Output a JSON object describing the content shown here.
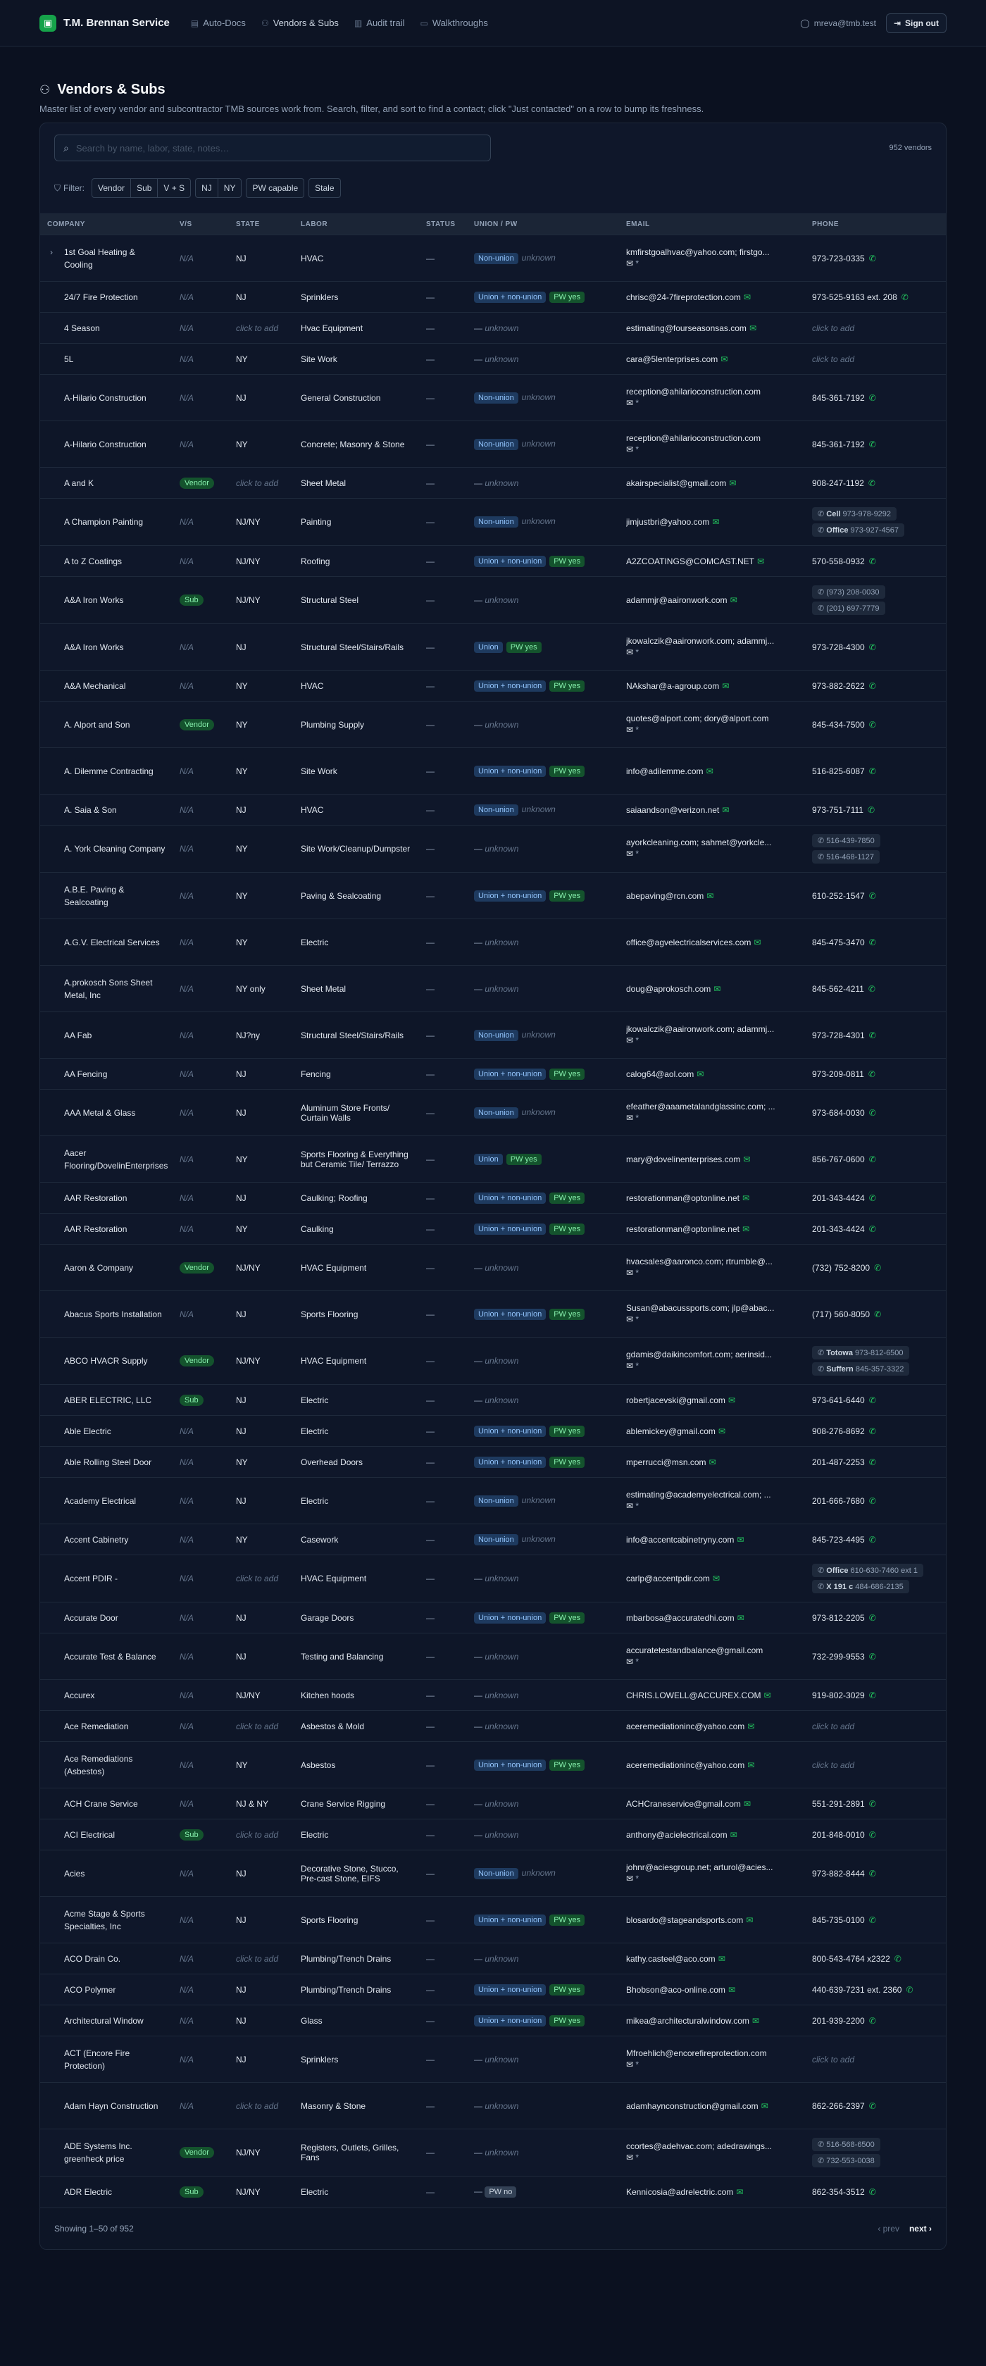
{
  "app": {
    "brand": "T.M. Brennan Service",
    "nav": [
      {
        "label": "Auto-Docs",
        "icon": "doc-icon"
      },
      {
        "label": "Vendors & Subs",
        "icon": "users-icon"
      },
      {
        "label": "Audit trail",
        "icon": "clipboard-icon"
      },
      {
        "label": "Walkthroughs",
        "icon": "video-icon"
      }
    ],
    "user": "mreva@tmb.test",
    "signout": "Sign out"
  },
  "page": {
    "title": "Vendors & Subs",
    "subtitle": "Master list of every vendor and subcontractor TMB sources work from. Search, filter, and sort to find a contact; click \"Just contacted\" on a row to bump its freshness."
  },
  "search": {
    "placeholder": "Search by name, labor, state, notes…",
    "count": "952 vendors"
  },
  "filters": {
    "label": "Filter:",
    "group1": [
      "Vendor",
      "Sub",
      "V + S"
    ],
    "group2": [
      "NJ",
      "NY"
    ],
    "pw": "PW capable",
    "stale": "Stale"
  },
  "columns": [
    "Company",
    "V/S",
    "State",
    "Labor",
    "Status",
    "Union / PW",
    "Email",
    "Phone"
  ],
  "rows": [
    {
      "company": "1st Goal Heating & Cooling",
      "vs": "N/A",
      "state": "NJ",
      "labor": "HVAC",
      "status": "—",
      "union": "Non-union",
      "pw": "unknown",
      "email": "kmfirstgoalhvac@yahoo.com; firstgo...",
      "email_more": true,
      "phone": "973-723-0335",
      "tall": true,
      "chev": true
    },
    {
      "company": "24/7 Fire Protection",
      "vs": "N/A",
      "state": "NJ",
      "labor": "Sprinklers",
      "status": "—",
      "union": "Union + non-union",
      "pw": "PW yes",
      "email": "chrisc@24-7fireprotection.com",
      "phone": "973-525-9163 ext. 208"
    },
    {
      "company": "4 Season",
      "vs": "N/A",
      "state": "click to add",
      "labor": "Hvac Equipment",
      "status": "—",
      "union": "",
      "pw": "unknown",
      "email": "estimating@fourseasonsas.com",
      "phone": "click to add"
    },
    {
      "company": "5L",
      "vs": "N/A",
      "state": "NY",
      "labor": "Site Work",
      "status": "—",
      "union": "",
      "pw": "unknown",
      "email": "cara@5lenterprises.com",
      "phone": "click to add"
    },
    {
      "company": "A-Hilario Construction",
      "vs": "N/A",
      "state": "NJ",
      "labor": "General Construction",
      "status": "—",
      "union": "Non-union",
      "pw": "unknown",
      "email": "reception@ahilarioconstruction.com",
      "email_more": true,
      "phone": "845-361-7192",
      "tall": true
    },
    {
      "company": "A-Hilario Construction",
      "vs": "N/A",
      "state": "NY",
      "labor": "Concrete; Masonry & Stone",
      "status": "—",
      "union": "Non-union",
      "pw": "unknown",
      "email": "reception@ahilarioconstruction.com",
      "email_more": true,
      "phone": "845-361-7192",
      "tall": true
    },
    {
      "company": "A and K",
      "vs": "Vendor",
      "state": "click to add",
      "labor": "Sheet Metal",
      "status": "—",
      "union": "",
      "pw": "unknown",
      "email": "akairspecialist@gmail.com",
      "phone": "908-247-1192"
    },
    {
      "company": "A Champion Painting",
      "vs": "N/A",
      "state": "NJ/NY",
      "labor": "Painting",
      "status": "—",
      "union": "Non-union",
      "pw": "unknown",
      "email": "jimjustbri@yahoo.com",
      "phones": [
        [
          "Cell",
          "973-978-9292"
        ],
        [
          "Office",
          "973-927-4567"
        ]
      ],
      "tall": true
    },
    {
      "company": "A to Z Coatings",
      "vs": "N/A",
      "state": "NJ/NY",
      "labor": "Roofing",
      "status": "—",
      "union": "Union + non-union",
      "pw": "PW yes",
      "email": "A2ZCOATINGS@COMCAST.NET",
      "phone": "570-558-0932"
    },
    {
      "company": "A&A Iron Works",
      "vs": "Sub",
      "state": "NJ/NY",
      "labor": "Structural Steel",
      "status": "—",
      "union": "",
      "pw": "unknown",
      "email": "adammjr@aaironwork.com",
      "phones": [
        [
          "",
          "(973) 208-0030"
        ],
        [
          "",
          "(201) 697-7779"
        ]
      ],
      "tall": true
    },
    {
      "company": "A&A Iron Works",
      "vs": "N/A",
      "state": "NJ",
      "labor": "Structural Steel/Stairs/Rails",
      "status": "—",
      "union": "Union",
      "pw": "PW yes",
      "email": "jkowalczik@aaironwork.com; adammj...",
      "email_more": true,
      "phone": "973-728-4300",
      "tall": true
    },
    {
      "company": "A&A Mechanical",
      "vs": "N/A",
      "state": "NY",
      "labor": "HVAC",
      "status": "—",
      "union": "Union + non-union",
      "pw": "PW yes",
      "email": "NAkshar@a-agroup.com",
      "phone": "973-882-2622"
    },
    {
      "company": "A. Alport and Son",
      "vs": "Vendor",
      "state": "NY",
      "labor": "Plumbing Supply",
      "status": "—",
      "union": "",
      "pw": "unknown",
      "email": "quotes@alport.com; dory@alport.com",
      "email_more": true,
      "phone": "845-434-7500",
      "tall": true
    },
    {
      "company": "A. Dilemme Contracting",
      "vs": "N/A",
      "state": "NY",
      "labor": "Site Work",
      "status": "—",
      "union": "Union + non-union",
      "pw": "PW yes",
      "email": "info@adilemme.com",
      "phone": "516-825-6087",
      "tall": true
    },
    {
      "company": "A. Saia & Son",
      "vs": "N/A",
      "state": "NJ",
      "labor": "HVAC",
      "status": "—",
      "union": "Non-union",
      "pw": "unknown",
      "email": "saiaandson@verizon.net",
      "phone": "973-751-7111"
    },
    {
      "company": "A. York Cleaning Company",
      "vs": "N/A",
      "state": "NY",
      "labor": "Site Work/Cleanup/Dumpster",
      "status": "—",
      "union": "",
      "pw": "unknown",
      "email": "ayorkcleaning.com; sahmet@yorkcle...",
      "email_more": true,
      "phones": [
        [
          "",
          "516-439-7850"
        ],
        [
          "",
          "516-468-1127"
        ]
      ],
      "tall": true
    },
    {
      "company": "A.B.E. Paving & Sealcoating",
      "vs": "N/A",
      "state": "NY",
      "labor": "Paving & Sealcoating",
      "status": "—",
      "union": "Union + non-union",
      "pw": "PW yes",
      "email": "abepaving@rcn.com",
      "phone": "610-252-1547",
      "tall": true
    },
    {
      "company": "A.G.V. Electrical Services",
      "vs": "N/A",
      "state": "NY",
      "labor": "Electric",
      "status": "—",
      "union": "",
      "pw": "unknown",
      "email": "office@agvelectricalservices.com",
      "phone": "845-475-3470",
      "tall": true
    },
    {
      "company": "A.prokosch Sons Sheet Metal, Inc",
      "vs": "N/A",
      "state": "NY only",
      "labor": "Sheet Metal",
      "status": "—",
      "union": "",
      "pw": "unknown",
      "email": "doug@aprokosch.com",
      "phone": "845-562-4211",
      "tall": true
    },
    {
      "company": "AA Fab",
      "vs": "N/A",
      "state": "NJ?ny",
      "labor": "Structural Steel/Stairs/Rails",
      "status": "—",
      "union": "Non-union",
      "pw": "unknown",
      "email": "jkowalczik@aaironwork.com; adammj...",
      "email_more": true,
      "phone": "973-728-4301",
      "tall": true
    },
    {
      "company": "AA Fencing",
      "vs": "N/A",
      "state": "NJ",
      "labor": "Fencing",
      "status": "—",
      "union": "Union + non-union",
      "pw": "PW yes",
      "email": "calog64@aol.com",
      "phone": "973-209-0811"
    },
    {
      "company": "AAA Metal & Glass",
      "vs": "N/A",
      "state": "NJ",
      "labor": "Aluminum Store Fronts/ Curtain Walls",
      "status": "—",
      "union": "Non-union",
      "pw": "unknown",
      "email": "efeather@aaametalandglassinc.com; ...",
      "email_more": true,
      "phone": "973-684-0030",
      "tall": true
    },
    {
      "company": "Aacer Flooring/DovelinEnterprises",
      "vs": "N/A",
      "state": "NY",
      "labor": "Sports Flooring & Everything but Ceramic Tile/ Terrazzo",
      "status": "—",
      "union": "Union",
      "pw": "PW yes",
      "email": "mary@dovelinenterprises.com",
      "phone": "856-767-0600",
      "tall": true
    },
    {
      "company": "AAR Restoration",
      "vs": "N/A",
      "state": "NJ",
      "labor": "Caulking; Roofing",
      "status": "—",
      "union": "Union + non-union",
      "pw": "PW yes",
      "email": "restorationman@optonline.net",
      "phone": "201-343-4424"
    },
    {
      "company": "AAR Restoration",
      "vs": "N/A",
      "state": "NY",
      "labor": "Caulking",
      "status": "—",
      "union": "Union + non-union",
      "pw": "PW yes",
      "email": "restorationman@optonline.net",
      "phone": "201-343-4424"
    },
    {
      "company": "Aaron & Company",
      "vs": "Vendor",
      "state": "NJ/NY",
      "labor": "HVAC Equipment",
      "status": "—",
      "union": "",
      "pw": "unknown",
      "email": "hvacsales@aaronco.com; rtrumble@...",
      "email_more": true,
      "phone": "(732) 752-8200",
      "tall": true
    },
    {
      "company": "Abacus Sports Installation",
      "vs": "N/A",
      "state": "NJ",
      "labor": "Sports Flooring",
      "status": "—",
      "union": "Union + non-union",
      "pw": "PW yes",
      "email": "Susan@abacussports.com; jlp@abac...",
      "email_more": true,
      "phone": "(717) 560-8050",
      "tall": true
    },
    {
      "company": "ABCO HVACR Supply",
      "vs": "Vendor",
      "state": "NJ/NY",
      "labor": "HVAC Equipment",
      "status": "—",
      "union": "",
      "pw": "unknown",
      "email": "gdamis@daikincomfort.com; aerinsid...",
      "email_more": true,
      "phones": [
        [
          "Totowa",
          "973-812-6500"
        ],
        [
          "Suffern",
          "845-357-3322"
        ]
      ],
      "tall": true
    },
    {
      "company": "ABER ELECTRIC, LLC",
      "vs": "Sub",
      "state": "NJ",
      "labor": "Electric",
      "status": "—",
      "union": "",
      "pw": "unknown",
      "email": "robertjacevski@gmail.com",
      "phone": "973-641-6440"
    },
    {
      "company": "Able Electric",
      "vs": "N/A",
      "state": "NJ",
      "labor": "Electric",
      "status": "—",
      "union": "Union + non-union",
      "pw": "PW yes",
      "email": "ablemickey@gmail.com",
      "phone": "908-276-8692"
    },
    {
      "company": "Able Rolling Steel Door",
      "vs": "N/A",
      "state": "NY",
      "labor": "Overhead Doors",
      "status": "—",
      "union": "Union + non-union",
      "pw": "PW yes",
      "email": "mperrucci@msn.com",
      "phone": "201-487-2253"
    },
    {
      "company": "Academy Electrical",
      "vs": "N/A",
      "state": "NJ",
      "labor": "Electric",
      "status": "—",
      "union": "Non-union",
      "pw": "unknown",
      "email": "estimating@academyelectrical.com; ...",
      "email_more": true,
      "phone": "201-666-7680",
      "tall": true
    },
    {
      "company": "Accent Cabinetry",
      "vs": "N/A",
      "state": "NY",
      "labor": "Casework",
      "status": "—",
      "union": "Non-union",
      "pw": "unknown",
      "email": "info@accentcabinetryny.com",
      "phone": "845-723-4495"
    },
    {
      "company": "Accent PDIR -",
      "vs": "N/A",
      "state": "click to add",
      "labor": "HVAC Equipment",
      "status": "—",
      "union": "",
      "pw": "unknown",
      "email": "carlp@accentpdir.com",
      "phones": [
        [
          "Office",
          "610-630-7460 ext 1"
        ],
        [
          "X 191 c",
          "484-686-2135"
        ]
      ],
      "tall": true
    },
    {
      "company": "Accurate Door",
      "vs": "N/A",
      "state": "NJ",
      "labor": "Garage Doors",
      "status": "—",
      "union": "Union + non-union",
      "pw": "PW yes",
      "email": "mbarbosa@accuratedhi.com",
      "phone": "973-812-2205"
    },
    {
      "company": "Accurate Test & Balance",
      "vs": "N/A",
      "state": "NJ",
      "labor": "Testing and Balancing",
      "status": "—",
      "union": "",
      "pw": "unknown",
      "email": "accuratetestandbalance@gmail.com",
      "email_more": true,
      "phone": "732-299-9553",
      "tall": true
    },
    {
      "company": "Accurex",
      "vs": "N/A",
      "state": "NJ/NY",
      "labor": "Kitchen hoods",
      "status": "—",
      "union": "",
      "pw": "unknown",
      "email": "CHRIS.LOWELL@ACCUREX.COM",
      "phone": "919-802-3029"
    },
    {
      "company": "Ace Remediation",
      "vs": "N/A",
      "state": "click to add",
      "labor": "Asbestos & Mold",
      "status": "—",
      "union": "",
      "pw": "unknown",
      "email": "aceremediationinc@yahoo.com",
      "phone": "click to add"
    },
    {
      "company": "Ace Remediations (Asbestos)",
      "vs": "N/A",
      "state": "NY",
      "labor": "Asbestos",
      "status": "—",
      "union": "Union + non-union",
      "pw": "PW yes",
      "email": "aceremediationinc@yahoo.com",
      "phone": "click to add",
      "tall": true
    },
    {
      "company": "ACH Crane Service",
      "vs": "N/A",
      "state": "NJ & NY",
      "labor": "Crane Service Rigging",
      "status": "—",
      "union": "",
      "pw": "unknown",
      "email": "ACHCraneservice@gmail.com",
      "phone": "551-291-2891"
    },
    {
      "company": "ACI Electrical",
      "vs": "Sub",
      "state": "click to add",
      "labor": "Electric",
      "status": "—",
      "union": "",
      "pw": "unknown",
      "email": "anthony@acielectrical.com",
      "phone": "201-848-0010"
    },
    {
      "company": "Acies",
      "vs": "N/A",
      "state": "NJ",
      "labor": "Decorative Stone, Stucco, Pre-cast Stone, EIFS",
      "status": "—",
      "union": "Non-union",
      "pw": "unknown",
      "email": "johnr@aciesgroup.net; arturol@acies...",
      "email_more": true,
      "phone": "973-882-8444",
      "tall": true
    },
    {
      "company": "Acme Stage & Sports Specialties, Inc",
      "vs": "N/A",
      "state": "NJ",
      "labor": "Sports Flooring",
      "status": "—",
      "union": "Union + non-union",
      "pw": "PW yes",
      "email": "blosardo@stageandsports.com",
      "phone": "845-735-0100",
      "tall": true
    },
    {
      "company": "ACO Drain Co.",
      "vs": "N/A",
      "state": "click to add",
      "labor": "Plumbing/Trench Drains",
      "status": "—",
      "union": "",
      "pw": "unknown",
      "email": "kathy.casteel@aco.com",
      "phone": "800-543-4764 x2322"
    },
    {
      "company": "ACO Polymer",
      "vs": "N/A",
      "state": "NJ",
      "labor": "Plumbing/Trench Drains",
      "status": "—",
      "union": "Union + non-union",
      "pw": "PW yes",
      "email": "Bhobson@aco-online.com",
      "phone": "440-639-7231 ext. 2360"
    },
    {
      "company": "Architectural Window",
      "vs": "N/A",
      "state": "NJ",
      "labor": "Glass",
      "status": "—",
      "union": "Union + non-union",
      "pw": "PW yes",
      "email": "mikea@architecturalwindow.com",
      "phone": "201-939-2200"
    },
    {
      "company": "ACT (Encore Fire Protection)",
      "vs": "N/A",
      "state": "NJ",
      "labor": "Sprinklers",
      "status": "—",
      "union": "",
      "pw": "unknown",
      "email": "Mfroehlich@encorefireprotection.com",
      "email_more": true,
      "phone": "click to add",
      "tall": true
    },
    {
      "company": "Adam Hayn Construction",
      "vs": "N/A",
      "state": "click to add",
      "labor": "Masonry & Stone",
      "status": "—",
      "union": "",
      "pw": "unknown",
      "email": "adamhaynconstruction@gmail.com",
      "phone": "862-266-2397",
      "tall": true
    },
    {
      "company": "ADE Systems Inc. greenheck price",
      "vs": "Vendor",
      "state": "NJ/NY",
      "labor": "Registers, Outlets, Grilles, Fans",
      "status": "—",
      "union": "",
      "pw": "unknown",
      "email": "ccortes@adehvac.com; adedrawings...",
      "email_more": true,
      "phones": [
        [
          "",
          "516-568-6500"
        ],
        [
          "",
          "732-553-0038"
        ]
      ],
      "tall": true
    },
    {
      "company": "ADR Electric",
      "vs": "Sub",
      "state": "NJ/NY",
      "labor": "Electric",
      "status": "—",
      "union": "",
      "pw": "PW no",
      "email": "Kennicosia@adrelectric.com",
      "phone": "862-354-3512"
    }
  ],
  "footer": {
    "showing": "Showing 1–50 of 952",
    "prev": "prev",
    "next": "next"
  }
}
